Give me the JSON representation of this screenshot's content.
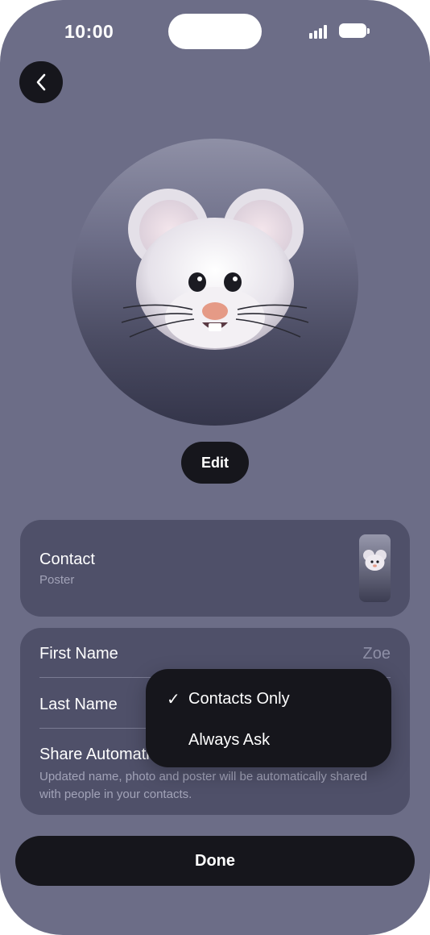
{
  "status_bar": {
    "time": "10:00"
  },
  "header": {
    "back_icon": "chevron-left-icon"
  },
  "avatar": {
    "image": "mouse-memoji"
  },
  "edit_label": "Edit",
  "contact_card": {
    "title": "Contact",
    "subtitle": "Poster"
  },
  "fields": {
    "first_name_label": "First Name",
    "first_name_value": "Zoe",
    "last_name_label": "Last Name",
    "share_label": "Share Automati",
    "share_description": "Updated name, photo and poster will be automatically shared with people in your contacts."
  },
  "menu": {
    "items": [
      {
        "label": "Contacts Only",
        "checked": true
      },
      {
        "label": "Always Ask",
        "checked": false
      }
    ],
    "check_glyph": "✓"
  },
  "done_label": "Done",
  "colors": {
    "background": "#6c6d87",
    "card": "#4f5069",
    "button": "#16161c"
  }
}
